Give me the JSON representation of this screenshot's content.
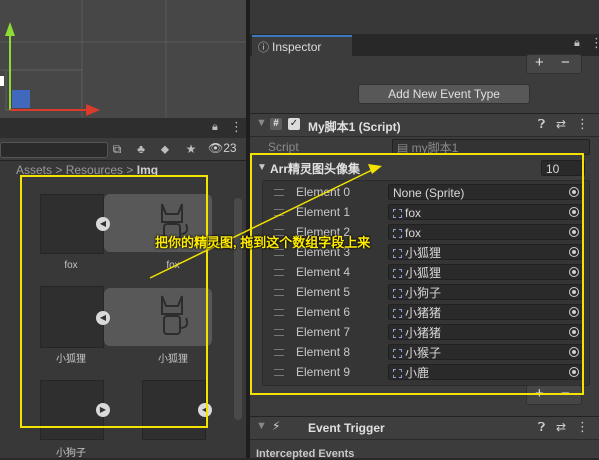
{
  "project": {
    "breadcrumb": [
      "Assets",
      "Resources",
      "Img"
    ],
    "hidden_count": "23",
    "assets": [
      {
        "label": "fox",
        "kind": "texture"
      },
      {
        "label": "fox",
        "kind": "sprite"
      },
      {
        "label": "小狐狸",
        "kind": "texture"
      },
      {
        "label": "小狐狸",
        "kind": "sprite"
      },
      {
        "label": "小狗子",
        "kind": "texture"
      },
      {
        "label": "",
        "kind": "texture"
      }
    ]
  },
  "inspector": {
    "tab_label": "Inspector",
    "add_event_button": "Add New Event Type",
    "component_title": "My脚本1 (Script)",
    "script_label": "Script",
    "script_value": "my脚本1",
    "array_label": "Arr精灵图头像集",
    "array_size": "10",
    "elements": [
      {
        "label": "Element 0",
        "value": "None (Sprite)"
      },
      {
        "label": "Element 1",
        "value": "fox"
      },
      {
        "label": "Element 2",
        "value": "fox"
      },
      {
        "label": "Element 3",
        "value": "小狐狸"
      },
      {
        "label": "Element 4",
        "value": "小狐狸"
      },
      {
        "label": "Element 5",
        "value": "小狗子"
      },
      {
        "label": "Element 6",
        "value": "小猪猪"
      },
      {
        "label": "Element 7",
        "value": "小猪猪"
      },
      {
        "label": "Element 8",
        "value": "小猴子"
      },
      {
        "label": "Element 9",
        "value": "小鹿"
      }
    ],
    "event_trigger_title": "Event Trigger",
    "intercepted_events": "Intercepted Events"
  },
  "annotation": "把你的精灵图, 拖到这个数组字段上来",
  "colors": {
    "highlight": "#f3e300",
    "tab_accent": "#3a79bb"
  }
}
